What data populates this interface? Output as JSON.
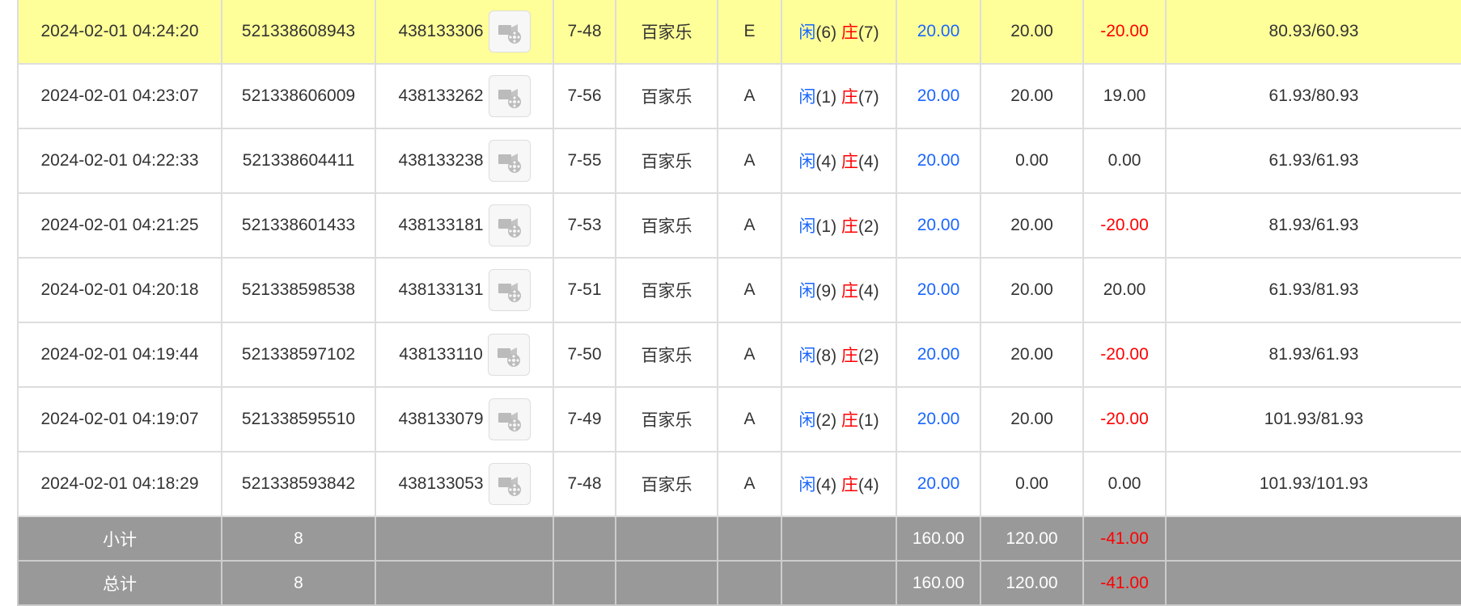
{
  "rows": [
    {
      "time": "2024-02-01 04:24:20",
      "bet_id": "521338608943",
      "round_id": "438133306",
      "shoe": "7-48",
      "game": "百家乐",
      "table": "E",
      "player_label": "闲",
      "player_val": "(6)",
      "banker_label": "庄",
      "banker_val": "(7)",
      "bet": "20.00",
      "valid": "20.00",
      "win": "-20.00",
      "win_negative": true,
      "balance": "80.93/60.93",
      "highlight": true
    },
    {
      "time": "2024-02-01 04:23:07",
      "bet_id": "521338606009",
      "round_id": "438133262",
      "shoe": "7-56",
      "game": "百家乐",
      "table": "A",
      "player_label": "闲",
      "player_val": "(1)",
      "banker_label": "庄",
      "banker_val": "(7)",
      "bet": "20.00",
      "valid": "20.00",
      "win": "19.00",
      "win_negative": false,
      "balance": "61.93/80.93",
      "highlight": false
    },
    {
      "time": "2024-02-01 04:22:33",
      "bet_id": "521338604411",
      "round_id": "438133238",
      "shoe": "7-55",
      "game": "百家乐",
      "table": "A",
      "player_label": "闲",
      "player_val": "(4)",
      "banker_label": "庄",
      "banker_val": "(4)",
      "bet": "20.00",
      "valid": "0.00",
      "win": "0.00",
      "win_negative": false,
      "balance": "61.93/61.93",
      "highlight": false
    },
    {
      "time": "2024-02-01 04:21:25",
      "bet_id": "521338601433",
      "round_id": "438133181",
      "shoe": "7-53",
      "game": "百家乐",
      "table": "A",
      "player_label": "闲",
      "player_val": "(1)",
      "banker_label": "庄",
      "banker_val": "(2)",
      "bet": "20.00",
      "valid": "20.00",
      "win": "-20.00",
      "win_negative": true,
      "balance": "81.93/61.93",
      "highlight": false
    },
    {
      "time": "2024-02-01 04:20:18",
      "bet_id": "521338598538",
      "round_id": "438133131",
      "shoe": "7-51",
      "game": "百家乐",
      "table": "A",
      "player_label": "闲",
      "player_val": "(9)",
      "banker_label": "庄",
      "banker_val": "(4)",
      "bet": "20.00",
      "valid": "20.00",
      "win": "20.00",
      "win_negative": false,
      "balance": "61.93/81.93",
      "highlight": false
    },
    {
      "time": "2024-02-01 04:19:44",
      "bet_id": "521338597102",
      "round_id": "438133110",
      "shoe": "7-50",
      "game": "百家乐",
      "table": "A",
      "player_label": "闲",
      "player_val": "(8)",
      "banker_label": "庄",
      "banker_val": "(2)",
      "bet": "20.00",
      "valid": "20.00",
      "win": "-20.00",
      "win_negative": true,
      "balance": "81.93/61.93",
      "highlight": false
    },
    {
      "time": "2024-02-01 04:19:07",
      "bet_id": "521338595510",
      "round_id": "438133079",
      "shoe": "7-49",
      "game": "百家乐",
      "table": "A",
      "player_label": "闲",
      "player_val": "(2)",
      "banker_label": "庄",
      "banker_val": "(1)",
      "bet": "20.00",
      "valid": "20.00",
      "win": "-20.00",
      "win_negative": true,
      "balance": "101.93/81.93",
      "highlight": false
    },
    {
      "time": "2024-02-01 04:18:29",
      "bet_id": "521338593842",
      "round_id": "438133053",
      "shoe": "7-48",
      "game": "百家乐",
      "table": "A",
      "player_label": "闲",
      "player_val": "(4)",
      "banker_label": "庄",
      "banker_val": "(4)",
      "bet": "20.00",
      "valid": "0.00",
      "win": "0.00",
      "win_negative": false,
      "balance": "101.93/101.93",
      "highlight": false
    }
  ],
  "subtotal": {
    "label": "小计",
    "count": "8",
    "bet": "160.00",
    "valid": "120.00",
    "win": "-41.00"
  },
  "total": {
    "label": "总计",
    "count": "8",
    "bet": "160.00",
    "valid": "120.00",
    "win": "-41.00"
  },
  "icons": {
    "video": "video-replay-icon"
  },
  "colors": {
    "highlight_row": "#ffff99",
    "player": "#1a66ff",
    "banker": "#ff0000",
    "negative": "#ff0000",
    "total_bg": "#999999"
  }
}
